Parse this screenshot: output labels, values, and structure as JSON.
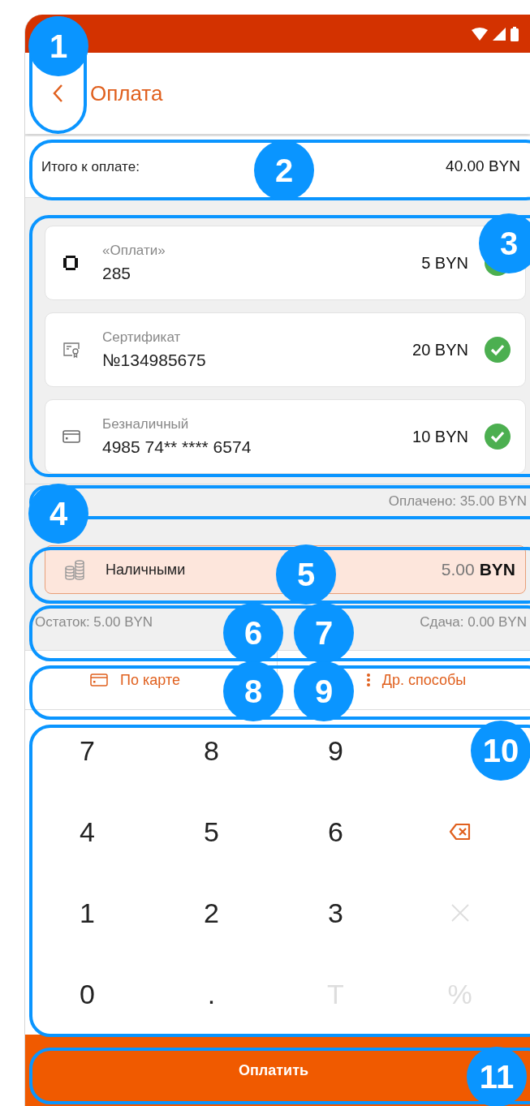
{
  "header": {
    "title": "Оплата"
  },
  "total": {
    "label": "Итого к оплате:",
    "amount": "40.00 BYN"
  },
  "payments": [
    {
      "kind": "wallet",
      "type_label": "«Оплати»",
      "value": "285",
      "amount": "5 BYN",
      "confirmed": true
    },
    {
      "kind": "certificate",
      "type_label": "Сертификат",
      "value": "№134985675",
      "amount": "20 BYN",
      "confirmed": true
    },
    {
      "kind": "card",
      "type_label": "Безналичный",
      "value": "4985 74** **** 6574",
      "amount": "10 BYN",
      "confirmed": true
    }
  ],
  "paid": "Оплачено: 35.00 BYN",
  "cash": {
    "label": "Наличными",
    "amount": "5.00",
    "currency": "BYN",
    "selected": true
  },
  "remainder": "Остаток: 5.00 BYN",
  "change": "Сдача: 0.00 BYN",
  "method_buttons": [
    {
      "kind": "card",
      "label": "По карте"
    },
    {
      "kind": "more",
      "label": "Др. способы"
    }
  ],
  "keypad": [
    {
      "kind": "text",
      "label": "7",
      "disabled": false
    },
    {
      "kind": "text",
      "label": "8",
      "disabled": false
    },
    {
      "kind": "text",
      "label": "9",
      "disabled": false
    },
    {
      "kind": "blank"
    },
    {
      "kind": "text",
      "label": "4",
      "disabled": false
    },
    {
      "kind": "text",
      "label": "5",
      "disabled": false
    },
    {
      "kind": "text",
      "label": "6",
      "disabled": false
    },
    {
      "kind": "backspace",
      "disabled": false
    },
    {
      "kind": "text",
      "label": "1",
      "disabled": false
    },
    {
      "kind": "text",
      "label": "2",
      "disabled": false
    },
    {
      "kind": "text",
      "label": "3",
      "disabled": false
    },
    {
      "kind": "multiply",
      "disabled": true
    },
    {
      "kind": "text",
      "label": "0",
      "disabled": false
    },
    {
      "kind": "text",
      "label": ".",
      "disabled": false
    },
    {
      "kind": "text",
      "label": "T",
      "disabled": true
    },
    {
      "kind": "text",
      "label": "%",
      "disabled": true
    }
  ],
  "pay_button": "Оплатить",
  "callouts": [
    {
      "number": "1"
    },
    {
      "number": "2"
    },
    {
      "number": "3"
    },
    {
      "number": "4"
    },
    {
      "number": "5"
    },
    {
      "number": "6"
    },
    {
      "number": "7"
    },
    {
      "number": "8"
    },
    {
      "number": "9"
    },
    {
      "number": "10"
    },
    {
      "number": "11"
    }
  ]
}
